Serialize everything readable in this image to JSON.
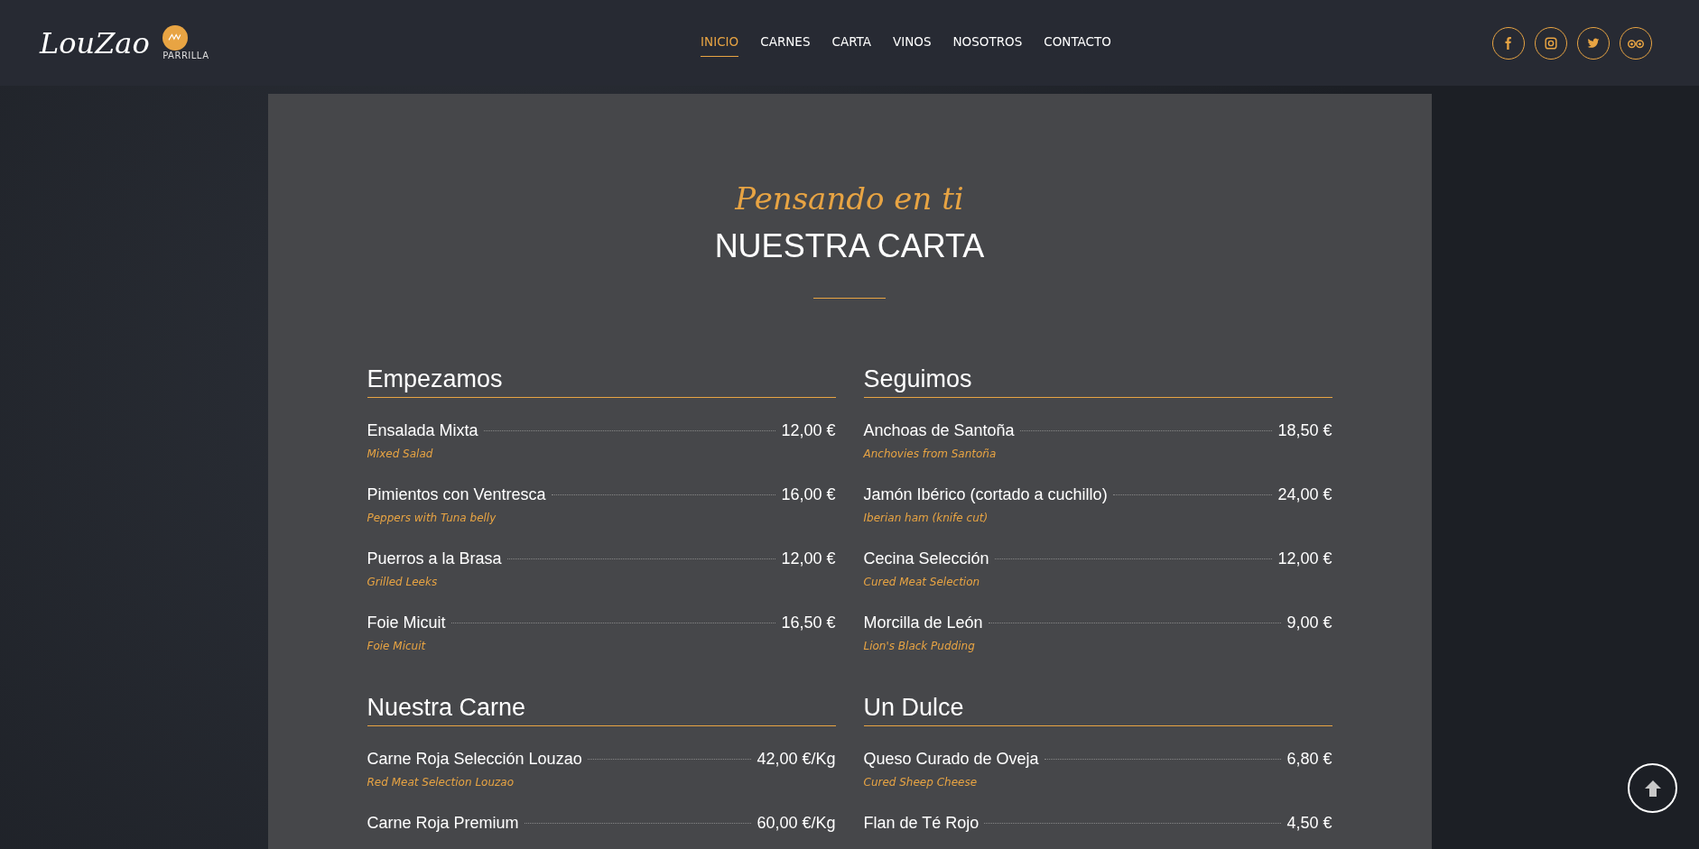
{
  "header": {
    "logo": {
      "script": "LouZao",
      "tagline": "PARRILLA"
    },
    "nav": [
      {
        "label": "INICIO",
        "selected": true
      },
      {
        "label": "CARNES",
        "selected": false
      },
      {
        "label": "CARTA",
        "selected": false
      },
      {
        "label": "VINOS",
        "selected": false
      },
      {
        "label": "NOSOTROS",
        "selected": false
      },
      {
        "label": "CONTACTO",
        "selected": false
      }
    ]
  },
  "menu": {
    "subtitle": "Pensando en ti",
    "title": "NUESTRA CARTA",
    "sections": [
      {
        "title": "Empezamos",
        "items": [
          {
            "name": "Ensalada Mixta",
            "price": "12,00 €",
            "translation": "Mixed Salad"
          },
          {
            "name": "Pimientos con Ventresca",
            "price": "16,00 €",
            "translation": "Peppers with Tuna belly"
          },
          {
            "name": "Puerros a la Brasa",
            "price": "12,00 €",
            "translation": "Grilled Leeks"
          },
          {
            "name": "Foie Micuit",
            "price": "16,50 €",
            "translation": "Foie Micuit"
          }
        ]
      },
      {
        "title": "Seguimos",
        "items": [
          {
            "name": "Anchoas de Santoña",
            "price": "18,50 €",
            "translation": "Anchovies from Santoña"
          },
          {
            "name": "Jamón Ibérico (cortado a cuchillo)",
            "price": "24,00 €",
            "translation": "Iberian ham (knife cut)"
          },
          {
            "name": "Cecina Selección",
            "price": "12,00 €",
            "translation": "Cured Meat Selection"
          },
          {
            "name": "Morcilla de León",
            "price": "9,00 €",
            "translation": "Lion's Black Pudding"
          }
        ]
      },
      {
        "title": "Nuestra Carne",
        "items": [
          {
            "name": "Carne Roja Selección Louzao",
            "price": "42,00 €/Kg",
            "translation": "Red Meat Selection Louzao"
          },
          {
            "name": "Carne Roja Premium",
            "price": "60,00 €/Kg"
          }
        ]
      },
      {
        "title": "Un Dulce",
        "items": [
          {
            "name": "Queso Curado de Oveja",
            "price": "6,80 €",
            "translation": "Cured Sheep Cheese"
          },
          {
            "name": "Flan de Té Rojo",
            "price": "4,50 €"
          }
        ]
      }
    ]
  }
}
